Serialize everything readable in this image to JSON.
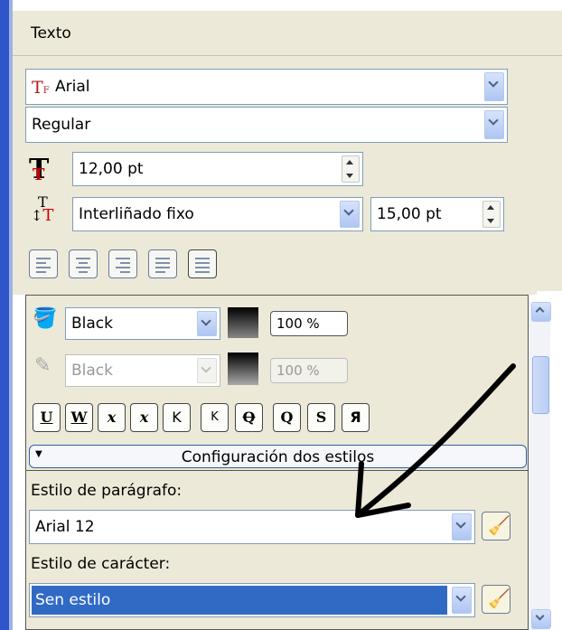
{
  "panel": {
    "title": "Texto"
  },
  "font": {
    "family": "Arial",
    "style": "Regular",
    "size": "12,00 pt"
  },
  "spacing": {
    "mode": "Interliñado fixo",
    "value": "15,00 pt"
  },
  "fill": {
    "color": "Black",
    "opacity": "100 %"
  },
  "outline": {
    "color": "Black",
    "opacity": "100 %"
  },
  "format_buttons": [
    "U",
    "W",
    "x",
    "x",
    "K",
    "K",
    "Q",
    "Q",
    "S",
    "Я"
  ],
  "styles": {
    "section_title": "Configuración dos estilos",
    "paragraph_label": "Estilo de parágrafo:",
    "paragraph_value": "Arial 12",
    "character_label": "Estilo de carácter:",
    "character_value": "Sen estilo"
  },
  "colors": {
    "selection": "#316ac5",
    "frame": "#2f56c9",
    "panel": "#ece9d8"
  },
  "icons": [
    "font-icon",
    "font-size-icon",
    "line-spacing-icon",
    "align-left-icon",
    "align-center-icon",
    "align-right-icon",
    "justify-icon",
    "justify-all-icon",
    "fill-bucket-icon",
    "outline-pen-icon",
    "broom-icon",
    "annotation-arrow"
  ]
}
